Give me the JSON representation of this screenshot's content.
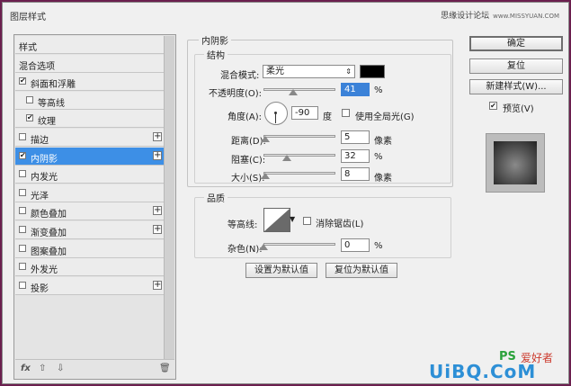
{
  "window": {
    "title": "图层样式",
    "site_text": "思缘设计论坛",
    "site_url": "www.MISSYUAN.COM"
  },
  "left_panel": {
    "items": [
      {
        "label": "样式",
        "checkbox": false,
        "checked": false,
        "plus": false,
        "selected": false,
        "indent": false
      },
      {
        "label": "混合选项",
        "checkbox": false,
        "checked": false,
        "plus": false,
        "selected": false,
        "indent": false
      },
      {
        "label": "斜面和浮雕",
        "checkbox": true,
        "checked": true,
        "plus": false,
        "selected": false,
        "indent": false
      },
      {
        "label": "等高线",
        "checkbox": true,
        "checked": false,
        "plus": false,
        "selected": false,
        "indent": true
      },
      {
        "label": "纹理",
        "checkbox": true,
        "checked": true,
        "plus": false,
        "selected": false,
        "indent": true
      },
      {
        "label": "描边",
        "checkbox": true,
        "checked": false,
        "plus": true,
        "selected": false,
        "indent": false
      },
      {
        "label": "内阴影",
        "checkbox": true,
        "checked": true,
        "plus": true,
        "selected": true,
        "indent": false
      },
      {
        "label": "内发光",
        "checkbox": true,
        "checked": false,
        "plus": false,
        "selected": false,
        "indent": false
      },
      {
        "label": "光泽",
        "checkbox": true,
        "checked": false,
        "plus": false,
        "selected": false,
        "indent": false
      },
      {
        "label": "颜色叠加",
        "checkbox": true,
        "checked": false,
        "plus": true,
        "selected": false,
        "indent": false
      },
      {
        "label": "渐变叠加",
        "checkbox": true,
        "checked": false,
        "plus": true,
        "selected": false,
        "indent": false
      },
      {
        "label": "图案叠加",
        "checkbox": true,
        "checked": false,
        "plus": false,
        "selected": false,
        "indent": false
      },
      {
        "label": "外发光",
        "checkbox": true,
        "checked": false,
        "plus": false,
        "selected": false,
        "indent": false
      },
      {
        "label": "投影",
        "checkbox": true,
        "checked": false,
        "plus": true,
        "selected": false,
        "indent": false
      }
    ],
    "footer": {
      "fx": "fx",
      "up": "⇧",
      "down": "⇩",
      "trash": "🗑"
    }
  },
  "inner_shadow": {
    "section_title": "内阴影",
    "structure_title": "结构",
    "blend_mode_label": "混合模式:",
    "blend_mode_value": "柔光",
    "blend_color": "#000000",
    "opacity_label": "不透明度(O):",
    "opacity_value": "41",
    "opacity_fraction": 0.41,
    "angle_label": "角度(A):",
    "angle_value": "-90",
    "angle_unit": "度",
    "global_light_label": "使用全局光(G)",
    "distance_label": "距离(D):",
    "distance_value": "5",
    "distance_fraction": 0.02,
    "choke_label": "阻塞(C):",
    "choke_value": "32",
    "choke_fraction": 0.32,
    "size_label": "大小(S):",
    "size_value": "8",
    "size_fraction": 0.03,
    "pixel_unit": "像素",
    "percent_unit": "%",
    "quality_title": "品质",
    "contour_label": "等高线:",
    "antialias_label": "消除锯齿(L)",
    "noise_label": "杂色(N):",
    "noise_value": "0",
    "noise_fraction": 0.0,
    "make_default": "设置为默认值",
    "reset_default": "复位为默认值"
  },
  "right_panel": {
    "ok": "确定",
    "reset": "复位",
    "new_style": "新建样式(W)...",
    "preview_label": "预览(V)",
    "preview_checked": true
  },
  "watermark": {
    "ps_logo": "PS",
    "ps_text": "爱好者",
    "brand": "UiBQ.CoM"
  }
}
